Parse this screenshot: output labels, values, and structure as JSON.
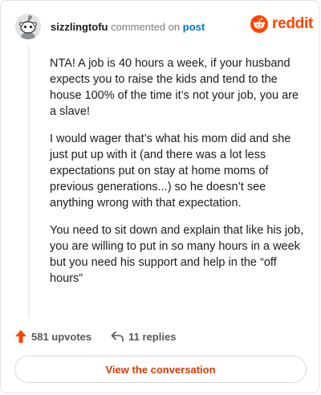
{
  "header": {
    "username": "sizzlingtofu",
    "action_text": "commented on",
    "post_link": "post"
  },
  "brand": {
    "name": "reddit",
    "color": "#ff4500"
  },
  "comment": {
    "paragraphs": [
      "NTA! A job is 40 hours a week, if your husband expects you to raise the kids and tend to the house 100% of the time it’s not your job, you are a slave!",
      "I would wager that’s what his mom did and she just put up with it (and there was a lot less expectations put on stay at home moms of previous generations...) so he doesn’t see anything wrong with that expectation.",
      "You need to sit down and explain that like his job, you are willing to put in so many hours in a week but you need his support and help in the “off hours”"
    ]
  },
  "actions": {
    "upvotes": "581 upvotes",
    "replies": "11 replies",
    "upvote_icon": "upvote-arrow-icon",
    "reply_icon": "reply-arrow-icon"
  },
  "cta": {
    "label": "View the conversation"
  },
  "colors": {
    "accent": "#ff4500",
    "link": "#0079d3",
    "cta_text": "#d93a00"
  }
}
